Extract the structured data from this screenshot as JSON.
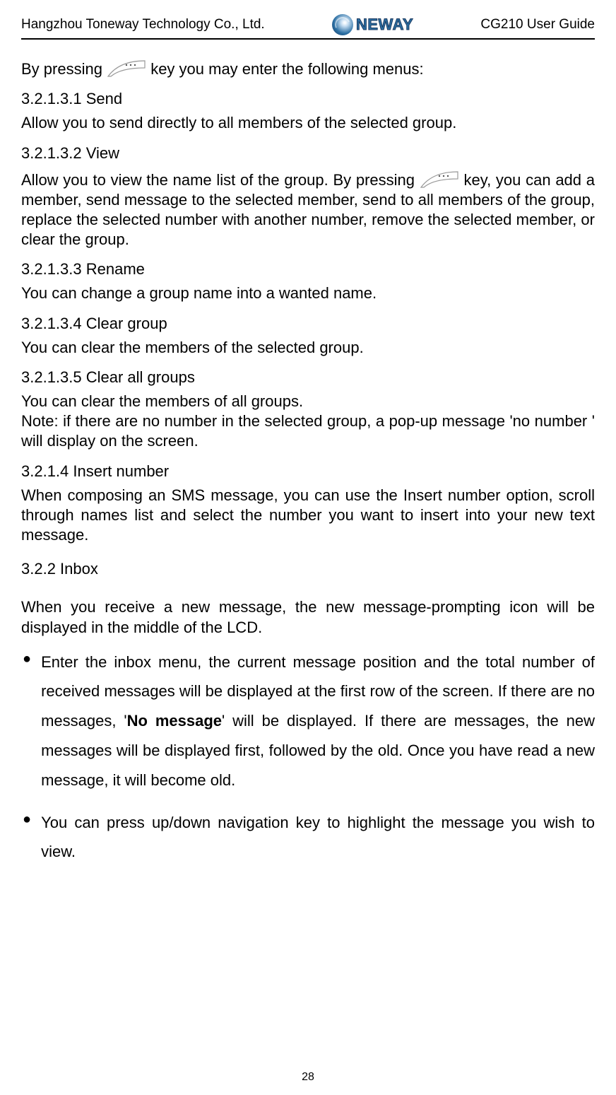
{
  "header": {
    "company": "Hangzhou Toneway Technology Co., Ltd.",
    "logo_text": "NEWAY",
    "guide": "CG210 User Guide"
  },
  "intro": {
    "prefix": "By pressing ",
    "suffix": " key you may enter the following menus:"
  },
  "sections": {
    "send": {
      "title": "3.2.1.3.1 Send",
      "body": "Allow you to send directly to all members of the selected group."
    },
    "view": {
      "title": "3.2.1.3.2 View",
      "body_prefix": "Allow you to view the name list of the group. By pressing ",
      "body_suffix": " key, you can add a member, send message to the selected member, send to all members of the group, replace the selected number with another number, remove the selected member, or clear the group."
    },
    "rename": {
      "title": "3.2.1.3.3 Rename",
      "body": "You can change a group name into a wanted name."
    },
    "cleargroup": {
      "title": "3.2.1.3.4 Clear group",
      "body": "You can clear the members of the selected group."
    },
    "clearall": {
      "title": "3.2.1.3.5 Clear all groups",
      "body": "You can clear the members of all groups.",
      "note": "Note: if there are no number in the selected group, a pop-up message 'no number ' will display on the screen."
    },
    "insert": {
      "title": "3.2.1.4 Insert number",
      "body": "When composing an SMS message, you can use the Insert number option, scroll through names list and select the number you want to insert into your new text message."
    },
    "inbox": {
      "title": "3.2.2 Inbox",
      "lead": "When you receive a new message, the new message-prompting icon will be displayed in the middle of the LCD.",
      "bullets": [
        {
          "pre": "Enter the inbox menu, the current message position and the total number of received messages will be displayed at the first row of the screen. If there are no messages, '",
          "bold": "No message",
          "post": "' will be displayed. If there are messages, the new messages will be displayed first, followed by the old. Once you have read a new message, it will become old."
        },
        {
          "pre": "You can press up/down navigation key to highlight the message you wish to view.",
          "bold": "",
          "post": ""
        }
      ]
    }
  },
  "page_number": "28"
}
